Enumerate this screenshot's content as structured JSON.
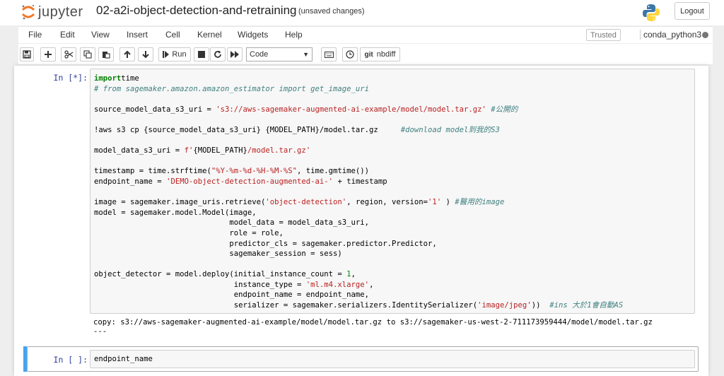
{
  "header": {
    "logo_text": "jupyter",
    "notebook_title": "02-a2i-object-detection-and-retraining",
    "save_status": "(unsaved changes)",
    "logout_label": "Logout"
  },
  "menubar": {
    "items": [
      "File",
      "Edit",
      "View",
      "Insert",
      "Cell",
      "Kernel",
      "Widgets",
      "Help"
    ],
    "trusted_label": "Trusted",
    "kernel_name": "conda_python3"
  },
  "toolbar": {
    "run_label": "Run",
    "cell_type": "Code",
    "nbdiff_label": "nbdiff",
    "git_label": "git"
  },
  "cells": [
    {
      "prompt": "In [*]:",
      "lines": [
        [
          [
            "kw",
            "import"
          ],
          [
            "",
            "time"
          ]
        ],
        [
          [
            "cm",
            "# from sagemaker.amazon.amazon_estimator import get_image_uri"
          ]
        ],
        [],
        [
          [
            "",
            "source_model_data_s3_uri = "
          ],
          [
            "st",
            "'s3://aws-sagemaker-augmented-ai-example/model/model.tar.gz'"
          ],
          [
            "cm",
            " #公開的"
          ]
        ],
        [],
        [
          [
            "",
            "!aws s3 cp {source_model_data_s3_uri} {MODEL_PATH}/model.tar.gz     "
          ],
          [
            "cm",
            "#download model到我的S3"
          ]
        ],
        [],
        [
          [
            "",
            "model_data_s3_uri = "
          ],
          [
            "st",
            "f'"
          ],
          [
            "",
            "{MODEL_PATH}"
          ],
          [
            "st",
            "/model.tar.gz'"
          ]
        ],
        [],
        [
          [
            "",
            "timestamp = time.strftime("
          ],
          [
            "st",
            "\"%Y-%m-%d-%H-%M-%S\""
          ],
          [
            "",
            ", time.gmtime())"
          ]
        ],
        [
          [
            "",
            "endpoint_name = "
          ],
          [
            "st",
            "'DEMO-object-detection-augmented-ai-'"
          ],
          [
            "",
            " + timestamp"
          ]
        ],
        [],
        [
          [
            "",
            "image = sagemaker.image_uris.retrieve("
          ],
          [
            "st",
            "'object-detection'"
          ],
          [
            "",
            ", region, version="
          ],
          [
            "st",
            "'1'"
          ],
          [
            "",
            " ) "
          ],
          [
            "cm",
            "#醫用的image"
          ]
        ],
        [
          [
            "",
            "model = sagemaker.model.Model(image,"
          ]
        ],
        [
          [
            "",
            "                              model_data = model_data_s3_uri,"
          ]
        ],
        [
          [
            "",
            "                              role = role,"
          ]
        ],
        [
          [
            "",
            "                              predictor_cls = sagemaker.predictor.Predictor,"
          ]
        ],
        [
          [
            "",
            "                              sagemaker_session = sess)"
          ]
        ],
        [],
        [
          [
            "",
            "object_detector = model.deploy(initial_instance_count = "
          ],
          [
            "nm",
            "1"
          ],
          [
            "",
            ","
          ]
        ],
        [
          [
            "",
            "                               instance_type = "
          ],
          [
            "st",
            "'ml.m4.xlarge'"
          ],
          [
            "",
            ","
          ]
        ],
        [
          [
            "",
            "                               endpoint_name = endpoint_name,"
          ]
        ],
        [
          [
            "",
            "                               serializer = sagemaker.serializers.IdentitySerializer("
          ],
          [
            "st",
            "'image/jpeg'"
          ],
          [
            "",
            "))  "
          ],
          [
            "cm",
            "#ins 大於1會自動AS"
          ]
        ]
      ],
      "output": [
        "copy: s3://aws-sagemaker-augmented-ai-example/model/model.tar.gz to s3://sagemaker-us-west-2-711173959444/model/model.tar.gz",
        "---"
      ]
    },
    {
      "prompt": "In [ ]:",
      "lines": [
        [
          [
            "",
            "endpoint_name"
          ]
        ]
      ]
    }
  ],
  "colors": {
    "prompt_blue": "#303f9f",
    "selected_bar": "#42a5f5",
    "keyword": "#008000",
    "comment": "#408080",
    "string": "#ba2121"
  }
}
